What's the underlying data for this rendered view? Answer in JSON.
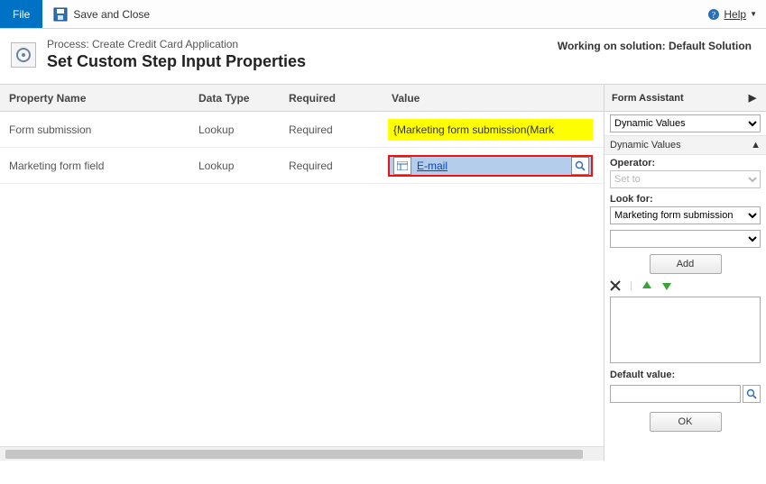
{
  "toolbar": {
    "file_label": "File",
    "save_close_label": "Save and Close",
    "help_label": "Help"
  },
  "header": {
    "process_prefix": "Process: ",
    "process_name": "Create Credit Card Application",
    "page_title": "Set Custom Step Input Properties",
    "solution_label": "Working on solution: Default Solution"
  },
  "grid": {
    "columns": {
      "name": "Property Name",
      "type": "Data Type",
      "required": "Required",
      "value": "Value"
    },
    "rows": [
      {
        "name": "Form submission",
        "type": "Lookup",
        "required": "Required",
        "value_kind": "dynamic",
        "value_text": "{Marketing form submission(Mark"
      },
      {
        "name": "Marketing form field",
        "type": "Lookup",
        "required": "Required",
        "value_kind": "lookup",
        "value_text": "E-mail"
      }
    ]
  },
  "assistant": {
    "title": "Form Assistant",
    "top_select": "Dynamic Values",
    "section_label": "Dynamic Values",
    "operator_label": "Operator:",
    "operator_value": "Set to",
    "lookfor_label": "Look for:",
    "lookfor_value": "Marketing form submission",
    "sub_select_value": "",
    "add_label": "Add",
    "default_label": "Default value:",
    "default_value": "",
    "ok_label": "OK"
  }
}
